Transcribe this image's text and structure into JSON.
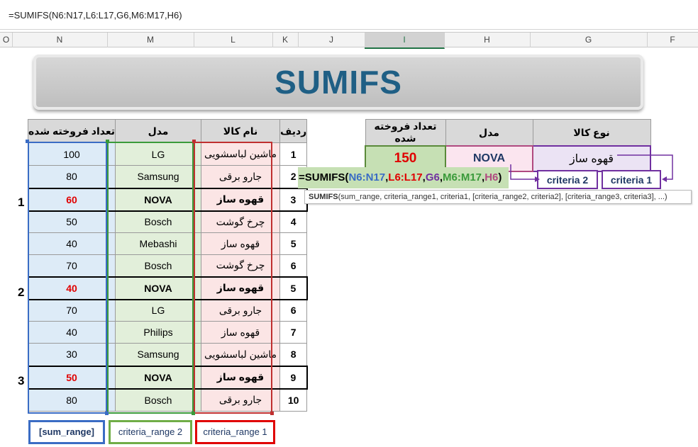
{
  "formula_bar": {
    "text": "=SUMIFS(N6:N17,L6:L17,G6,M6:M17,H6)"
  },
  "columns": [
    "O",
    "N",
    "M",
    "L",
    "K",
    "J",
    "I",
    "H",
    "G",
    "F"
  ],
  "banner": {
    "title": "SUMIFS"
  },
  "data_table": {
    "headers": {
      "n": "تعداد فروخته شده",
      "m": "مدل",
      "l": "نام کالا",
      "k": "ردیف"
    },
    "rows": [
      {
        "n": "100",
        "m": "LG",
        "l": "ماشین لباسشویی",
        "k": "1"
      },
      {
        "n": "80",
        "m": "Samsung",
        "l": "جارو برقی",
        "k": "2"
      },
      {
        "n": "60",
        "m": "NOVA",
        "l": "قهوه ساز",
        "k": "3"
      },
      {
        "n": "50",
        "m": "Bosch",
        "l": "چرخ گوشت",
        "k": "4"
      },
      {
        "n": "40",
        "m": "Mebashi",
        "l": "قهوه ساز",
        "k": "5"
      },
      {
        "n": "70",
        "m": "Bosch",
        "l": "چرخ گوشت",
        "k": "6"
      },
      {
        "n": "40",
        "m": "NOVA",
        "l": "قهوه ساز",
        "k": "5"
      },
      {
        "n": "70",
        "m": "LG",
        "l": "جارو برقی",
        "k": "6"
      },
      {
        "n": "40",
        "m": "Philips",
        "l": "قهوه ساز",
        "k": "7"
      },
      {
        "n": "30",
        "m": "Samsung",
        "l": "ماشین لباسشویی",
        "k": "8"
      },
      {
        "n": "50",
        "m": "NOVA",
        "l": "قهوه ساز",
        "k": "9"
      },
      {
        "n": "80",
        "m": "Bosch",
        "l": "جارو برقی",
        "k": "10"
      }
    ]
  },
  "match_numbers": [
    "1",
    "2",
    "3"
  ],
  "range_labels": {
    "sum_range": "[sum_range]",
    "criteria_range2": "criteria_range 2",
    "criteria_range1": "criteria_range 1"
  },
  "result_table": {
    "headers": {
      "i": "تعداد فروخته شده",
      "h": "مدل",
      "g": "نوع کالا"
    },
    "values": {
      "i": "150",
      "h": "NOVA",
      "g": "قهوه ساز"
    }
  },
  "formula_cell": {
    "prefix": "=SUMIFS(",
    "arg1": "N6:N17",
    "arg2": "L6:L17",
    "arg3": "G6",
    "arg4": "M6:M17",
    "arg5": "H6",
    "suffix": ")",
    "sep": ","
  },
  "tooltip": {
    "fn": "SUMIFS",
    "args": "(sum_range, criteria_range1, criteria1, [criteria_range2, criteria2], [criteria_range3, criteria3], ...)"
  },
  "criteria_labels": {
    "c2": "criteria 2",
    "c1": "criteria 1"
  },
  "colors": {
    "sum_range": "#3a6cc4",
    "criteria_range2": "#3a9a3a",
    "criteria_range1": "#e00000",
    "criteria": "#7030a0",
    "banner_text": "#1f5f85"
  }
}
